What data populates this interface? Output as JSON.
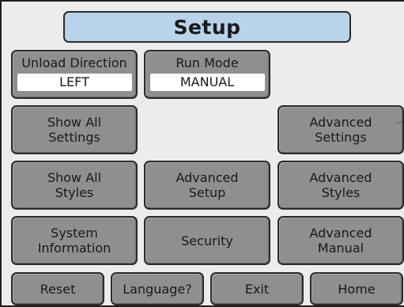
{
  "title": "Setup",
  "unload_direction": {
    "label": "Unload Direction",
    "value": "LEFT"
  },
  "run_mode": {
    "label": "Run Mode",
    "value": "MANUAL"
  },
  "buttons": {
    "show_all_settings": "Show All\nSettings",
    "advanced_settings": "Advanced\nSettings",
    "show_all_styles": "Show All\nStyles",
    "advanced_setup": "Advanced\nSetup",
    "advanced_styles": "Advanced\nStyles",
    "system_information": "System\nInformation",
    "security": "Security",
    "advanced_manual": "Advanced\nManual"
  },
  "bottom": {
    "reset": "Reset",
    "language": "Language?",
    "exit": "Exit",
    "home": "Home"
  },
  "colors": {
    "title_bg": "#b8d3ea",
    "button_bg": "#8f8f8f",
    "screen_bg": "#ececec"
  }
}
